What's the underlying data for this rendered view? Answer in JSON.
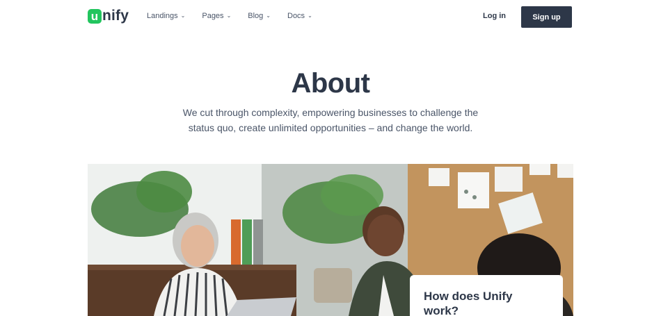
{
  "brand": {
    "logo_letter": "u",
    "logo_rest": "nify",
    "accent": "#22c55e",
    "ink": "#2d3748"
  },
  "nav": {
    "items": [
      {
        "label": "Landings",
        "icon": "chevron-down-icon"
      },
      {
        "label": "Pages",
        "icon": "chevron-down-icon"
      },
      {
        "label": "Blog",
        "icon": "chevron-down-icon"
      },
      {
        "label": "Docs",
        "icon": "chevron-down-icon"
      }
    ],
    "login_label": "Log in",
    "signup_label": "Sign up"
  },
  "hero": {
    "title": "About",
    "subtitle": "We cut through complexity, empowering businesses to challenge the status quo, create unlimited opportunities – and change the world."
  },
  "card": {
    "title": "How does Unify work?"
  }
}
